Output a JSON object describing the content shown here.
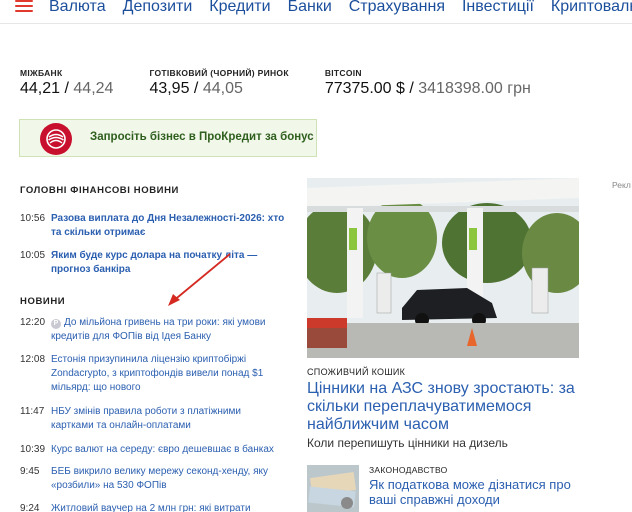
{
  "nav": {
    "items": [
      "Валюта",
      "Депозити",
      "Кредити",
      "Банки",
      "Страхування",
      "Інвестиції",
      "Криптовалюта"
    ]
  },
  "rates": [
    {
      "title": "Міжбанк",
      "main": "44,21",
      "sep": " / ",
      "secondary": "44,24"
    },
    {
      "title": "Готівковий (чорний) ринок",
      "main": "43,95",
      "sep": " / ",
      "secondary": "44,05"
    },
    {
      "title": "Bitcoin",
      "main": "77375.00 $",
      "sep": " / ",
      "secondary": "3418398.00 грн"
    }
  ],
  "banner": {
    "text": "Запросіть бізнес в ПроКредит за бонус"
  },
  "main_news": {
    "heading": "Головні фінансові новини",
    "items": [
      {
        "time": "10:56",
        "title": "Разова виплата до Дня Незалежності-2026: хто та скільки отримає"
      },
      {
        "time": "10:05",
        "title": "Яким буде курс долара на початку літа — прогноз банкіра"
      }
    ]
  },
  "news": {
    "heading": "Новини",
    "items": [
      {
        "time": "12:20",
        "badge": "P",
        "title": "До мільйона гривень на три роки: які умови кредитів для ФОПів від Ідея Банку"
      },
      {
        "time": "12:08",
        "title": "Естонія призупинила ліцензію криптобіржі Zondacrypto, з криптофондів вивели понад $1 мільярд: що нового"
      },
      {
        "time": "11:47",
        "title": "НБУ змінів правила роботи з платіжними картками та онлайн-оплатами"
      },
      {
        "time": "10:39",
        "title": "Курс валют на середу: євро дешевшає в банках"
      },
      {
        "time": "9:45",
        "title": "БЕБ викрило велику мережу секонд-хенду, яку «розбили» на 530 ФОПів"
      },
      {
        "time": "9:24",
        "title": "Житловий ваучер на 2 млн грн: які витрати"
      }
    ]
  },
  "right": {
    "ad_label": "Рекл",
    "featured": {
      "category": "Споживчий кошик",
      "headline": "Цінники на АЗС знову зростають: за скільки переплачуватимемося найближчим часом",
      "subline": "Коли перепишуть цінники на дизель"
    },
    "second": {
      "category": "Законодавство",
      "headline": "Як податкова може дізнатися про ваші справжні доходи"
    }
  },
  "colors": {
    "accent": "#e03a2f",
    "link": "#2b5fb0",
    "nav": "#1b4f9c"
  }
}
